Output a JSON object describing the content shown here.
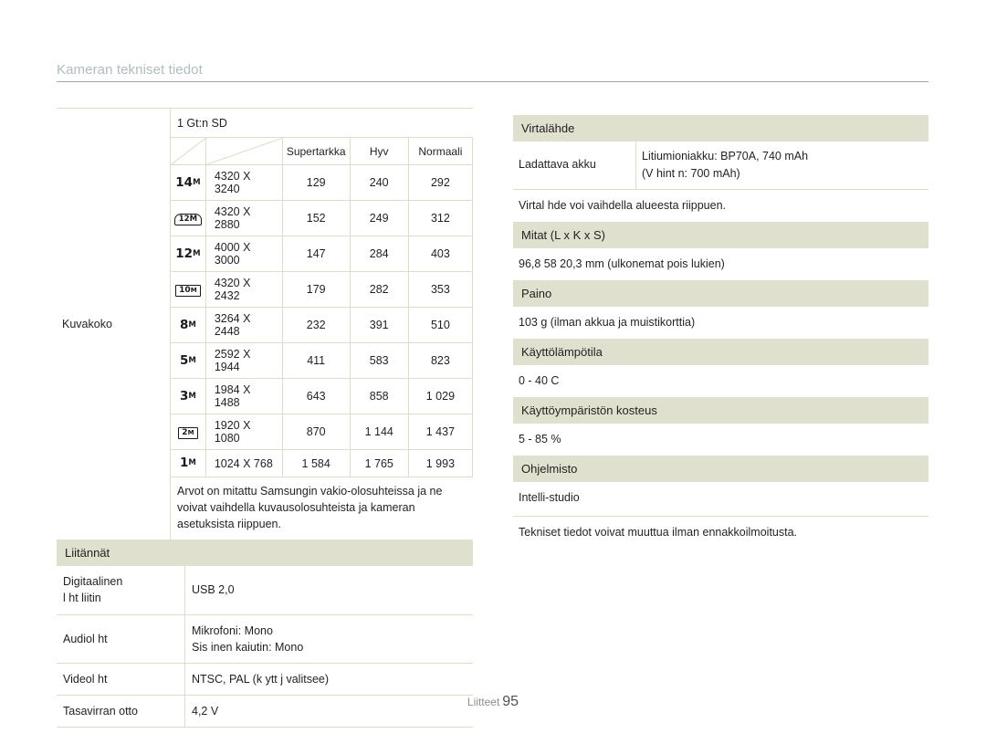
{
  "header": {
    "running_title": "Kameran tekniset tiedot"
  },
  "image_size": {
    "row_label": "Kuvakoko",
    "card_caption": "1 Gt:n SD",
    "columns": [
      "",
      "",
      "Supertarkka",
      "Hyv",
      "Normaali"
    ],
    "rows": [
      {
        "icon": "14m-icon",
        "icon_text": "14",
        "icon_style": "plain",
        "resolution": "4320 X 3240",
        "superfine": "129",
        "fine": "240",
        "normal": "292"
      },
      {
        "icon": "12m-wide-icon",
        "icon_text": "12",
        "icon_style": "round",
        "resolution": "4320 X 2880",
        "superfine": "152",
        "fine": "249",
        "normal": "312"
      },
      {
        "icon": "12m-icon",
        "icon_text": "12",
        "icon_style": "plain",
        "resolution": "4000 X 3000",
        "superfine": "147",
        "fine": "284",
        "normal": "403"
      },
      {
        "icon": "10m-wide-icon",
        "icon_text": "10",
        "icon_style": "wide",
        "resolution": "4320 X 2432",
        "superfine": "179",
        "fine": "282",
        "normal": "353"
      },
      {
        "icon": "8m-icon",
        "icon_text": "8",
        "icon_style": "plain",
        "resolution": "3264 X 2448",
        "superfine": "232",
        "fine": "391",
        "normal": "510"
      },
      {
        "icon": "5m-icon",
        "icon_text": "5",
        "icon_style": "plain",
        "resolution": "2592 X 1944",
        "superfine": "411",
        "fine": "583",
        "normal": "823"
      },
      {
        "icon": "3m-icon",
        "icon_text": "3",
        "icon_style": "plain",
        "resolution": "1984 X 1488",
        "superfine": "643",
        "fine": "858",
        "normal": "1 029"
      },
      {
        "icon": "2m-wide-icon",
        "icon_text": "2",
        "icon_style": "wide",
        "resolution": "1920 X 1080",
        "superfine": "870",
        "fine": "1 144",
        "normal": "1 437"
      },
      {
        "icon": "1m-icon",
        "icon_text": "1",
        "icon_style": "plain",
        "resolution": "1024 X 768",
        "superfine": "1 584",
        "fine": "1 765",
        "normal": "1 993"
      }
    ],
    "footnote": "Arvot on mitattu Samsungin vakio-olosuhteissa ja ne voivat vaihdella kuvausolosuhteista ja kameran asetuksista riippuen."
  },
  "connectors": {
    "band": "Liitännät",
    "rows": [
      {
        "key": "Digitaalinen\nl ht  liitin",
        "key_line1": "Digitaalinen",
        "key_line2": "l ht  liitin",
        "value_line1": "USB 2,0",
        "value_line2": ""
      },
      {
        "key_line1": "Audiol ht",
        "key_line2": "",
        "value_line1": "Mikrofoni: Mono",
        "value_line2": "Sis  inen kaiutin: Mono"
      },
      {
        "key_line1": "Videol ht",
        "key_line2": "",
        "value_line1": "NTSC, PAL (k ytt j  valitsee)",
        "value_line2": ""
      },
      {
        "key_line1": "Tasavirran otto",
        "key_line2": "",
        "value_line1": "4,2 V",
        "value_line2": ""
      }
    ]
  },
  "right": {
    "power": {
      "band": "Virtalähde",
      "key": "Ladattava akku",
      "value_line1": "Litiumioniakku: BP70A, 740 mAh",
      "value_line2": "(V hint   n: 700 mAh)",
      "note": "Virtal hde voi vaihdella alueesta riippuen."
    },
    "dimensions": {
      "band": "Mitat (L x K x S)",
      "value": "96,8   58   20,3 mm (ulkonemat pois lukien)"
    },
    "weight": {
      "band": "Paino",
      "value": "103 g (ilman akkua ja muistikorttia)"
    },
    "temperature": {
      "band": "Käyttölämpötila",
      "value": "0 - 40 C"
    },
    "humidity": {
      "band": "Käyttöympäristön kosteus",
      "value": "5 - 85 %"
    },
    "software": {
      "band": "Ohjelmisto",
      "value": "Intelli-studio"
    },
    "disclaimer": "Tekniset tiedot voivat muuttua ilman ennakkoilmoitusta."
  },
  "footer": {
    "section": "Liitteet",
    "page": "95"
  },
  "colors": {
    "band": "#dfe0ce",
    "rule": "#ddddc8",
    "running_title": "#aebdc0",
    "text": "#231f20"
  }
}
